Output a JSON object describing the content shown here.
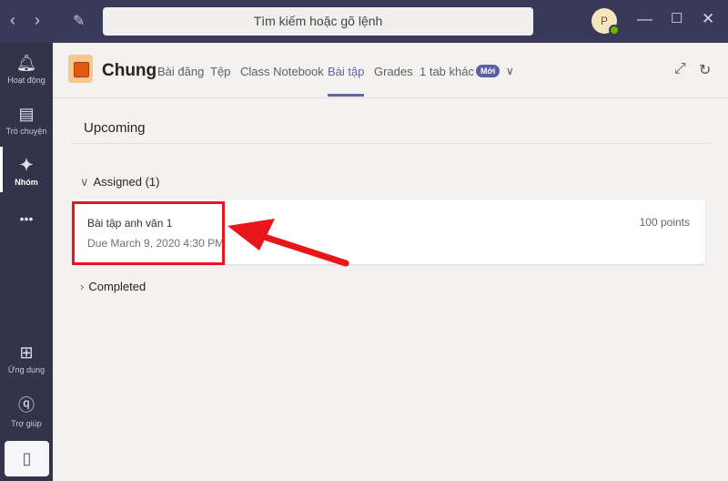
{
  "titlebar": {
    "search_placeholder": "Tìm kiếm hoặc gõ lệnh",
    "avatar_initial": "P"
  },
  "sidebar": {
    "items": [
      {
        "label": "Hoạt động",
        "icon": "bell-icon"
      },
      {
        "label": "Trò chuyện",
        "icon": "chat-icon"
      },
      {
        "label": "Nhóm",
        "icon": "teams-icon"
      },
      {
        "label": "•••",
        "icon": "more-icon"
      },
      {
        "label": "Ứng dụng",
        "icon": "apps-icon"
      },
      {
        "label": "Trợ giúp",
        "icon": "help-icon"
      }
    ]
  },
  "header": {
    "channel": "Chung",
    "tabs": [
      "Bài đăng",
      "Tệp",
      "Class Notebook",
      "Bài tập",
      "Grades",
      "1 tab khác"
    ],
    "active_tab": "Bài tập",
    "badge": "Mới"
  },
  "main": {
    "heading": "Upcoming",
    "assigned_label": "Assigned (1)",
    "assignments": [
      {
        "title": "Bài tập anh văn 1",
        "due": "Due March 9, 2020 4:30 PM",
        "points": "100 points"
      }
    ],
    "completed_label": "Completed"
  },
  "colors": {
    "accent": "#6264a7",
    "titlebar": "#393a5a",
    "sidebar": "#33344a",
    "annotation": "#e8161b"
  }
}
